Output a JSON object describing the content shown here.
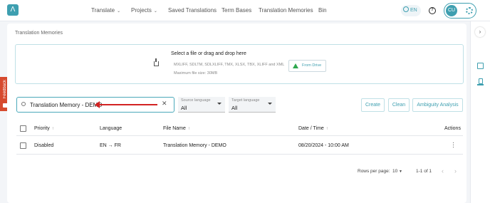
{
  "nav": {
    "logo": "Λ",
    "items": [
      {
        "label": "Translate",
        "has_dropdown": true
      },
      {
        "label": "Projects",
        "has_dropdown": true
      },
      {
        "label": "Saved Translations",
        "has_dropdown": false
      },
      {
        "label": "Term Bases",
        "has_dropdown": false
      },
      {
        "label": "Translation Memories",
        "has_dropdown": false
      },
      {
        "label": "Bin",
        "has_dropdown": false
      }
    ],
    "language": "EN",
    "help": "?",
    "user_initials": "CU"
  },
  "feedback": {
    "label": "Feedback"
  },
  "page": {
    "title": "Translation Memories"
  },
  "dropzone": {
    "title": "Select a file or drag and drop here",
    "formats": "MXLIFF, SDLTM, SDLXLIFF, TMX, XLSX, TBX, XLIFF and XML",
    "max_size": "Maximum file size: 30MB",
    "drive_button": "From Drive"
  },
  "search": {
    "value": "Translation Memory - DEMO",
    "clear": "✕"
  },
  "filters": {
    "source": {
      "label": "Source language",
      "value": "All"
    },
    "target": {
      "label": "Target language",
      "value": "All"
    }
  },
  "actions": {
    "create": "Create",
    "clean": "Clean",
    "ambiguity": "Ambiguity Analysis"
  },
  "table": {
    "headers": {
      "priority": "Priority",
      "language": "Language",
      "file_name": "File Name",
      "date_time": "Date / Time",
      "actions": "Actions"
    },
    "sort_icon": "↑",
    "rows": [
      {
        "priority": "Disabled",
        "language": "EN → FR",
        "file_name": "Translation Memory - DEMO",
        "date_time": "08/20/2024 - 10:00 AM"
      }
    ]
  },
  "pagination": {
    "rows_per_page_label": "Rows per page:",
    "rows_per_page": "10",
    "range": "1-1 of 1"
  },
  "colors": {
    "accent": "#3e9fb0",
    "feedback": "#d64a2e",
    "annotation_arrow": "#d32222"
  }
}
